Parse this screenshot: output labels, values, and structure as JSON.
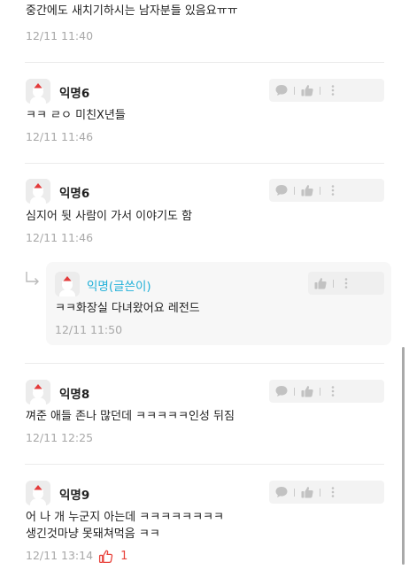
{
  "comments": [
    {
      "text": "중간에도 새치기하시는 남자분들 있음요ㅠㅠ",
      "time": "12/11 11:40"
    },
    {
      "author": "익명6",
      "text": "ㅋㅋ ㄹㅇ 미친X년들",
      "time": "12/11 11:46"
    },
    {
      "author": "익명6",
      "text": "심지어 뒷 사람이 가서 이야기도 함",
      "time": "12/11 11:46"
    },
    {
      "author": "익명(글쓴이)",
      "text": "ㅋㅋ화장실 다녀왔어요 레전드",
      "time": "12/11 11:50",
      "is_reply": true
    },
    {
      "author": "익명8",
      "text": "껴준 애들 존나 많던데 ㅋㅋㅋㅋㅋ인성 뒤짐",
      "time": "12/11 12:25"
    },
    {
      "author": "익명9",
      "text_line1": "어 나 개 누군지 아는데 ㅋㅋㅋㅋㅋㅋㅋㅋ",
      "text_line2": "생긴것마냥 못돼쳐먹음 ㅋㅋ",
      "time": "12/11 13:14",
      "likes": "1"
    }
  ],
  "colors": {
    "op_name": "#21b0d8",
    "like_red": "#e8423b",
    "time_gray": "#a8a8a8",
    "action_bg": "#f3f3f3"
  },
  "icons": {
    "reply": "speech-bubble-icon",
    "like": "thumbs-up-icon",
    "more": "vertical-dots-icon",
    "reply_arrow": "reply-arrow-icon",
    "avatar": "anonymous-avatar-icon"
  }
}
